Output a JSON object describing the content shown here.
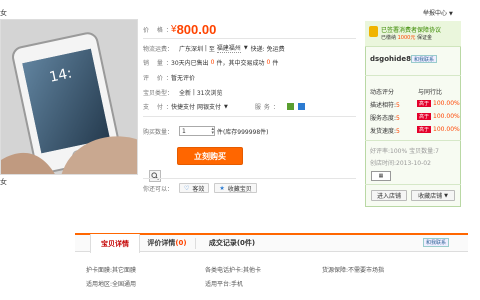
{
  "header": {
    "breadcrumb": "女",
    "report": "举报中心"
  },
  "product_image": {
    "caption": "女"
  },
  "info": {
    "price_label": "价  格：",
    "price_symbol": "¥",
    "price_value": "800.00",
    "shipping_label": "物流运费：",
    "shipping_from": "广东深圳",
    "shipping_to_label": "至",
    "shipping_to": "福建福州",
    "shipping_fee": "快递: 免运费",
    "sales_label": "销  量：",
    "sales_text": "30天内已售出",
    "sales_count": "0",
    "sales_text2": "件，其中交易成功",
    "sales_success": "0",
    "sales_unit": "件",
    "review_label": "评  价：",
    "review_value": "暂无评价",
    "type_label": "宝贝类型：",
    "type_value": "全新",
    "views": "31次浏览",
    "pay_label": "支  付：",
    "pay_value": "快捷支付",
    "pay_value2": "网银支付",
    "service_label": "服务：",
    "qty_label": "购买数量：",
    "qty_value": "1",
    "qty_unit": "件",
    "stock": "(库存999998件)",
    "buy_button": "立刻购买",
    "share_label": "你还可以：",
    "share_button": "客效",
    "fav_button": "收藏宝贝"
  },
  "seller": {
    "promise": "已签署消费者保障协议",
    "deposit_pre": "已缴纳",
    "deposit_amount": "1000元",
    "deposit_post": "保证金",
    "name": "dsgohide8",
    "wangwang": "和我联系",
    "dsr_title": "动态评分",
    "dsr_compare": "与同行比",
    "scores": [
      {
        "label": "描述相符:",
        "value": "5",
        "badge": "高于",
        "pct": "100.00%"
      },
      {
        "label": "服务态度:",
        "value": "5",
        "badge": "高于",
        "pct": "100.00%"
      },
      {
        "label": "发货速度:",
        "value": "5",
        "badge": "高于",
        "pct": "100.00%"
      }
    ],
    "praise": "好评率:100%",
    "credit_label": "宝贝数量:",
    "credit_value": "7",
    "created": "创店时间:2013-10-02",
    "enter_shop": "进入店铺",
    "fav_shop": "收藏店铺"
  },
  "tabs": {
    "detail": "宝贝详情",
    "reviews": "评价详情",
    "reviews_count": "(0)",
    "records": "成交记录",
    "records_count": "(0件)",
    "contact": "和我联系"
  },
  "specs": {
    "a_label": "护卡面膜:",
    "a_value": "其它面膜",
    "b_label": "各类电话护卡:",
    "b_value": "其他卡",
    "c_label": "货源保障:",
    "c_value": "不需要市场指",
    "d_label": "适用地区:",
    "d_value": "全国通用",
    "e_label": "适用平台:",
    "e_value": "手机"
  }
}
